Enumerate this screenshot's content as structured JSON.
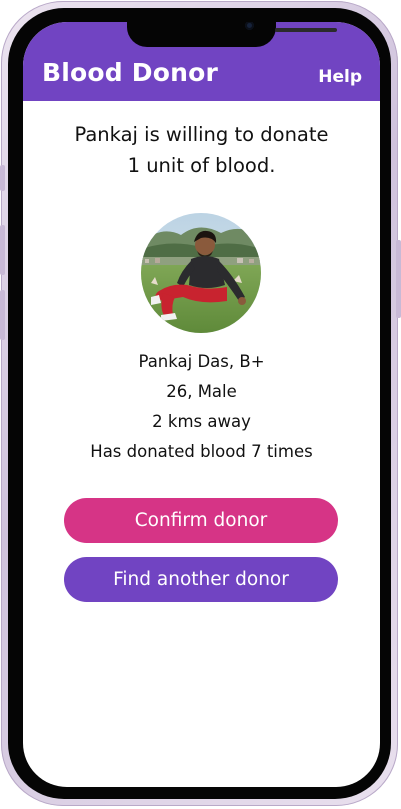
{
  "app": {
    "title": "Blood Donor",
    "help_label": "Help",
    "brand_color": "#7144c2"
  },
  "donor": {
    "headline_line1": "Pankaj is willing to donate",
    "headline_line2": "1 unit of blood.",
    "photo_icon": "donor-photo",
    "name_blood_group": "Pankaj Das, B+",
    "age_gender": "26, Male",
    "distance": "2 kms away",
    "donation_count": "Has donated blood 7 times"
  },
  "actions": {
    "confirm_label": "Confirm donor",
    "confirm_color": "#d63486",
    "find_label": "Find another donor",
    "find_color": "#7144c2"
  }
}
